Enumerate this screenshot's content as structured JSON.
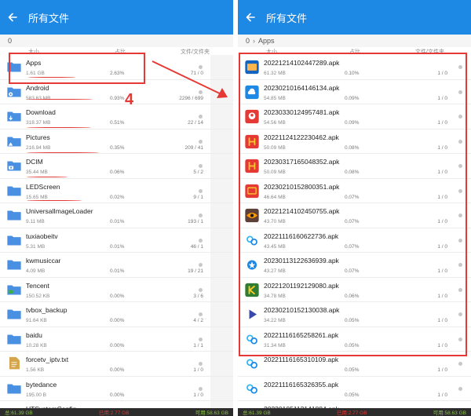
{
  "colors": {
    "appbar": "#1e88e5",
    "annotation": "#e53935",
    "folder": "#4a90e2"
  },
  "left": {
    "title": "所有文件",
    "breadcrumb": [
      "0"
    ],
    "columns": {
      "size": "大小",
      "ratio": "占比",
      "files": "文件/文件夹"
    },
    "rows": [
      {
        "name": "Apps",
        "size": "1.61 GB",
        "pct": "2.63%",
        "count": "71 / 0",
        "icon": "folder-icon"
      },
      {
        "name": "Android",
        "size": "583.63 MB",
        "pct": "0.93%",
        "count": "2296 / 699",
        "icon": "settings-folder-icon"
      },
      {
        "name": "Download",
        "size": "318.37 MB",
        "pct": "0.51%",
        "count": "22 / 14",
        "icon": "download-folder-icon"
      },
      {
        "name": "Pictures",
        "size": "216.94 MB",
        "pct": "0.35%",
        "count": "209 / 41",
        "icon": "image-folder-icon"
      },
      {
        "name": "DCIM",
        "size": "35.44 MB",
        "pct": "0.06%",
        "count": "5 / 2",
        "icon": "camera-folder-icon"
      },
      {
        "name": "LEDScreen",
        "size": "15.65 MB",
        "pct": "0.02%",
        "count": "9 / 1",
        "icon": "folder-icon"
      },
      {
        "name": "UniversalImageLoader",
        "size": "9.11 MB",
        "pct": "0.01%",
        "count": "193 / 1",
        "icon": "folder-icon"
      },
      {
        "name": "tuxiaobeitv",
        "size": "5.31 MB",
        "pct": "0.01%",
        "count": "46 / 1",
        "icon": "folder-icon"
      },
      {
        "name": "kwmusiccar",
        "size": "4.09 MB",
        "pct": "0.01%",
        "count": "19 / 21",
        "icon": "folder-icon"
      },
      {
        "name": "Tencent",
        "size": "150.52 KB",
        "pct": "0.00%",
        "count": "3 / 6",
        "icon": "chat-folder-icon"
      },
      {
        "name": "tvbox_backup",
        "size": "91.64 KB",
        "pct": "0.00%",
        "count": "4 / 2",
        "icon": "folder-icon"
      },
      {
        "name": "baidu",
        "size": "10.28 KB",
        "pct": "0.00%",
        "count": "1 / 1",
        "icon": "folder-icon"
      },
      {
        "name": "forcetv_iptv.txt",
        "size": "1.56 KB",
        "pct": "0.00%",
        "count": "1 / 0",
        "icon": "text-file-icon"
      },
      {
        "name": "bytedance",
        "size": "195.00 B",
        "pct": "0.00%",
        "count": "1 / 0",
        "icon": "folder-icon"
      },
      {
        "name": "UTSystemConfig",
        "size": "",
        "pct": "",
        "count": "",
        "icon": "folder-icon"
      }
    ],
    "footer": {
      "total": "总:61.39 GB",
      "used": "已用:2.77 GB",
      "free": "可用:58.63 GB"
    }
  },
  "right": {
    "title": "所有文件",
    "breadcrumb": [
      "0",
      "Apps"
    ],
    "columns": {
      "size": "大小",
      "ratio": "占比",
      "files": "文件/文件夹"
    },
    "rows": [
      {
        "name": "20221214102447289.apk",
        "size": "61.32 MB",
        "pct": "0.10%",
        "count": "1 / 0",
        "icon": "tv-app-icon"
      },
      {
        "name": "20230210164146134.apk",
        "size": "54.85 MB",
        "pct": "0.09%",
        "count": "1 / 0",
        "icon": "cloud-app-icon"
      },
      {
        "name": "20230330124957481.apk",
        "size": "54.56 MB",
        "pct": "0.09%",
        "count": "1 / 0",
        "icon": "bird-app-icon"
      },
      {
        "name": "20221124122230462.apk",
        "size": "50.09 MB",
        "pct": "0.08%",
        "count": "1 / 0",
        "icon": "video-app-icon"
      },
      {
        "name": "20230317165048352.apk",
        "size": "50.09 MB",
        "pct": "0.08%",
        "count": "1 / 0",
        "icon": "video-app-icon"
      },
      {
        "name": "20230210152800351.apk",
        "size": "46.64 MB",
        "pct": "0.07%",
        "count": "1 / 0",
        "icon": "tv-red-app-icon"
      },
      {
        "name": "20221214102450755.apk",
        "size": "43.70 MB",
        "pct": "0.07%",
        "count": "1 / 0",
        "icon": "eye-app-icon"
      },
      {
        "name": "20221116160622736.apk",
        "size": "43.45 MB",
        "pct": "0.07%",
        "count": "1 / 0",
        "icon": "circles-app-icon"
      },
      {
        "name": "20230113122636939.apk",
        "size": "43.27 MB",
        "pct": "0.07%",
        "count": "1 / 0",
        "icon": "star-app-icon"
      },
      {
        "name": "20221201192129080.apk",
        "size": "34.78 MB",
        "pct": "0.06%",
        "count": "1 / 0",
        "icon": "k-app-icon"
      },
      {
        "name": "20230210152130038.apk",
        "size": "34.22 MB",
        "pct": "0.05%",
        "count": "1 / 0",
        "icon": "play-app-icon"
      },
      {
        "name": "20221116165258261.apk",
        "size": "31.34 MB",
        "pct": "0.05%",
        "count": "1 / 0",
        "icon": "circles-app-icon"
      },
      {
        "name": "20221116165310109.apk",
        "size": "",
        "pct": "0.05%",
        "count": "1 / 0",
        "icon": "circles-app-icon"
      },
      {
        "name": "20221116165326355.apk",
        "size": "",
        "pct": "0.05%",
        "count": "1 / 0",
        "icon": "circles-app-icon"
      },
      {
        "name": "20230105113141884.apk",
        "size": "",
        "pct": "",
        "count": "",
        "icon": "circles-app-icon"
      }
    ],
    "footer": {
      "total": "总:61.39 GB",
      "used": "已用:2.77 GB",
      "free": "可用:58.63 GB"
    }
  },
  "annotation": {
    "number": "4"
  }
}
